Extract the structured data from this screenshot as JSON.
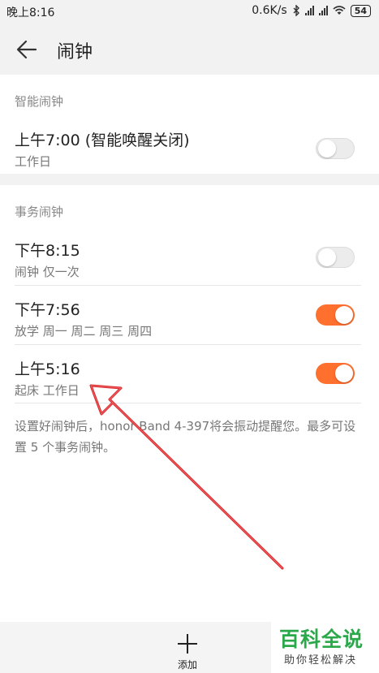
{
  "status_bar": {
    "time": "晚上8:16",
    "net_speed": "0.6K/s",
    "battery": "54"
  },
  "app_bar": {
    "title": "闹钟"
  },
  "smart_alarm": {
    "header": "智能闹钟",
    "item": {
      "time": "上午7:00 (智能唤醒关闭)",
      "subtitle": "工作日",
      "enabled": false
    }
  },
  "event_alarms": {
    "header": "事务闹钟",
    "items": [
      {
        "time": "下午8:15",
        "subtitle": "闹钟  仅一次",
        "enabled": false
      },
      {
        "time": "下午7:56",
        "subtitle": "放学  周一 周二 周三 周四",
        "enabled": true
      },
      {
        "time": "上午5:16",
        "subtitle": "起床  工作日",
        "enabled": true
      }
    ]
  },
  "note": "设置好闹钟后，honor Band 4-397将会振动提醒您。最多可设置 5 个事务闹钟。",
  "bottom_bar": {
    "add_label": "添加"
  },
  "watermark": {
    "title": "百科全说",
    "subtitle": "助你轻松解决"
  },
  "colors": {
    "accent": "#ff6f2e",
    "watermark": "#2ba84a",
    "annotation": "#d9282c"
  },
  "icons": {
    "back": "arrow-left-icon",
    "add": "plus-icon",
    "annotation": "red-arrow"
  }
}
